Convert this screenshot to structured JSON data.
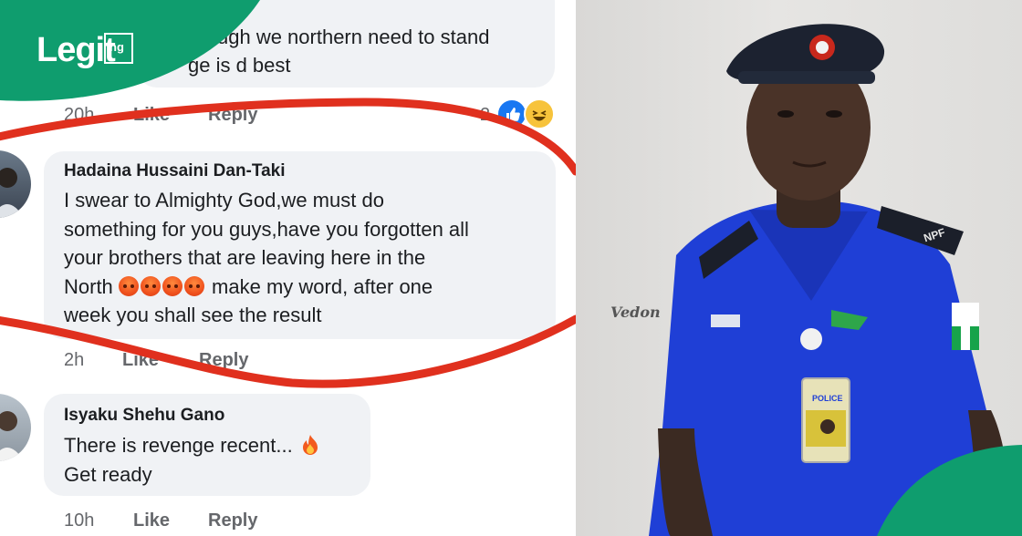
{
  "brand": {
    "logo_text": "Legit",
    "logo_suffix": "ng",
    "accent": "#0f9d6e"
  },
  "comments": [
    {
      "text_lines": [
        "ugh we northern need to stand",
        "ge is d best"
      ],
      "time": "20h",
      "like": "Like",
      "reply": "Reply",
      "reaction_count": "2"
    },
    {
      "author": "Hadaina Hussaini Dan-Taki",
      "text_lines": [
        "I swear to Almighty God,we must do",
        "something for you guys,have you forgotten all",
        "your brothers that are leaving here in the",
        "make my word, after one",
        "week you shall see the result"
      ],
      "north_word": "North",
      "emojis": [
        "angry-face",
        "angry-face",
        "angry-face",
        "angry-face"
      ],
      "time": "2h",
      "like": "Like",
      "reply": "Reply"
    },
    {
      "author": "Isyaku Shehu Gano",
      "text_lines": [
        "There is revenge recent...",
        "Get ready"
      ],
      "emoji": "fire",
      "time": "10h",
      "like": "Like",
      "reply": "Reply"
    }
  ],
  "photo": {
    "badge_label": "POLICE",
    "epaulette": "NPF",
    "signature": "Vedon"
  },
  "colors": {
    "uniform_blue": "#1f3fd6",
    "circle_red": "#e0301e",
    "bubble_bg": "#f0f2f5",
    "meta_gray": "#65676b"
  }
}
